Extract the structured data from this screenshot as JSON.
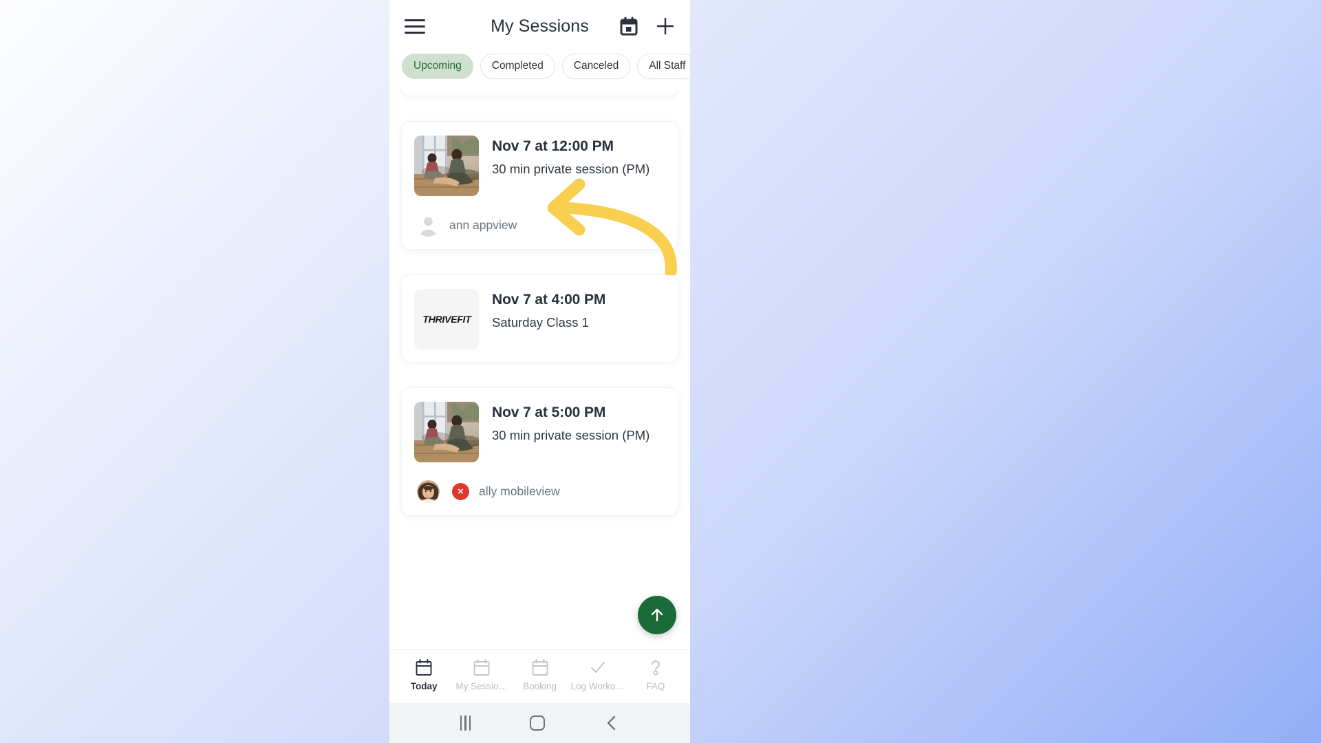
{
  "header": {
    "title": "My Sessions",
    "menu_icon": "hamburger-menu-icon",
    "calendar_icon": "calendar-icon",
    "add_icon": "plus-icon"
  },
  "filters": [
    {
      "label": "Upcoming",
      "active": true
    },
    {
      "label": "Completed",
      "active": false
    },
    {
      "label": "Canceled",
      "active": false
    },
    {
      "label": "All Staff",
      "active": false
    }
  ],
  "sessions": [
    {
      "time": "Nov 7 at 12:00 PM",
      "description": "30 min private session (PM)",
      "thumb_type": "photo",
      "person": {
        "name": "ann appview",
        "avatar_type": "placeholder",
        "has_cancel_badge": false
      }
    },
    {
      "time": "Nov 7 at 4:00 PM",
      "description": "Saturday Class 1",
      "thumb_type": "logo",
      "logo_bold": "THRIVE",
      "logo_light": "FIT",
      "person": null
    },
    {
      "time": "Nov 7 at 5:00 PM",
      "description": "30 min private session (PM)",
      "thumb_type": "photo",
      "person": {
        "name": "ally mobileview",
        "avatar_type": "photo",
        "has_cancel_badge": true,
        "badge_glyph": "×"
      }
    }
  ],
  "fab": {
    "icon": "arrow-up-icon",
    "color": "#1b6b38"
  },
  "tabs": [
    {
      "label": "Today",
      "icon": "calendar-today-icon",
      "active": true
    },
    {
      "label": "My Sessio…",
      "icon": "calendar-icon",
      "active": false
    },
    {
      "label": "Booking",
      "icon": "calendar-icon",
      "active": false
    },
    {
      "label": "Log Worko…",
      "icon": "check-icon",
      "active": false
    },
    {
      "label": "FAQ",
      "icon": "question-mark-icon",
      "active": false
    }
  ],
  "system_nav": [
    {
      "name": "recent-apps-button",
      "glyph": "|||"
    },
    {
      "name": "home-button",
      "glyph": "▢"
    },
    {
      "name": "back-button",
      "glyph": "‹"
    }
  ],
  "annotation": {
    "type": "curved-arrow",
    "color": "#f8cf4f",
    "points_to": "first session card"
  },
  "colors": {
    "accent_green": "#1b6b38",
    "chip_active_bg": "#cfe0cf",
    "chip_active_text": "#1e6b3a",
    "badge_red": "#e0372c",
    "annotation_yellow": "#f8cf4f",
    "text_primary": "#2b303b",
    "text_muted": "#6d7480"
  }
}
